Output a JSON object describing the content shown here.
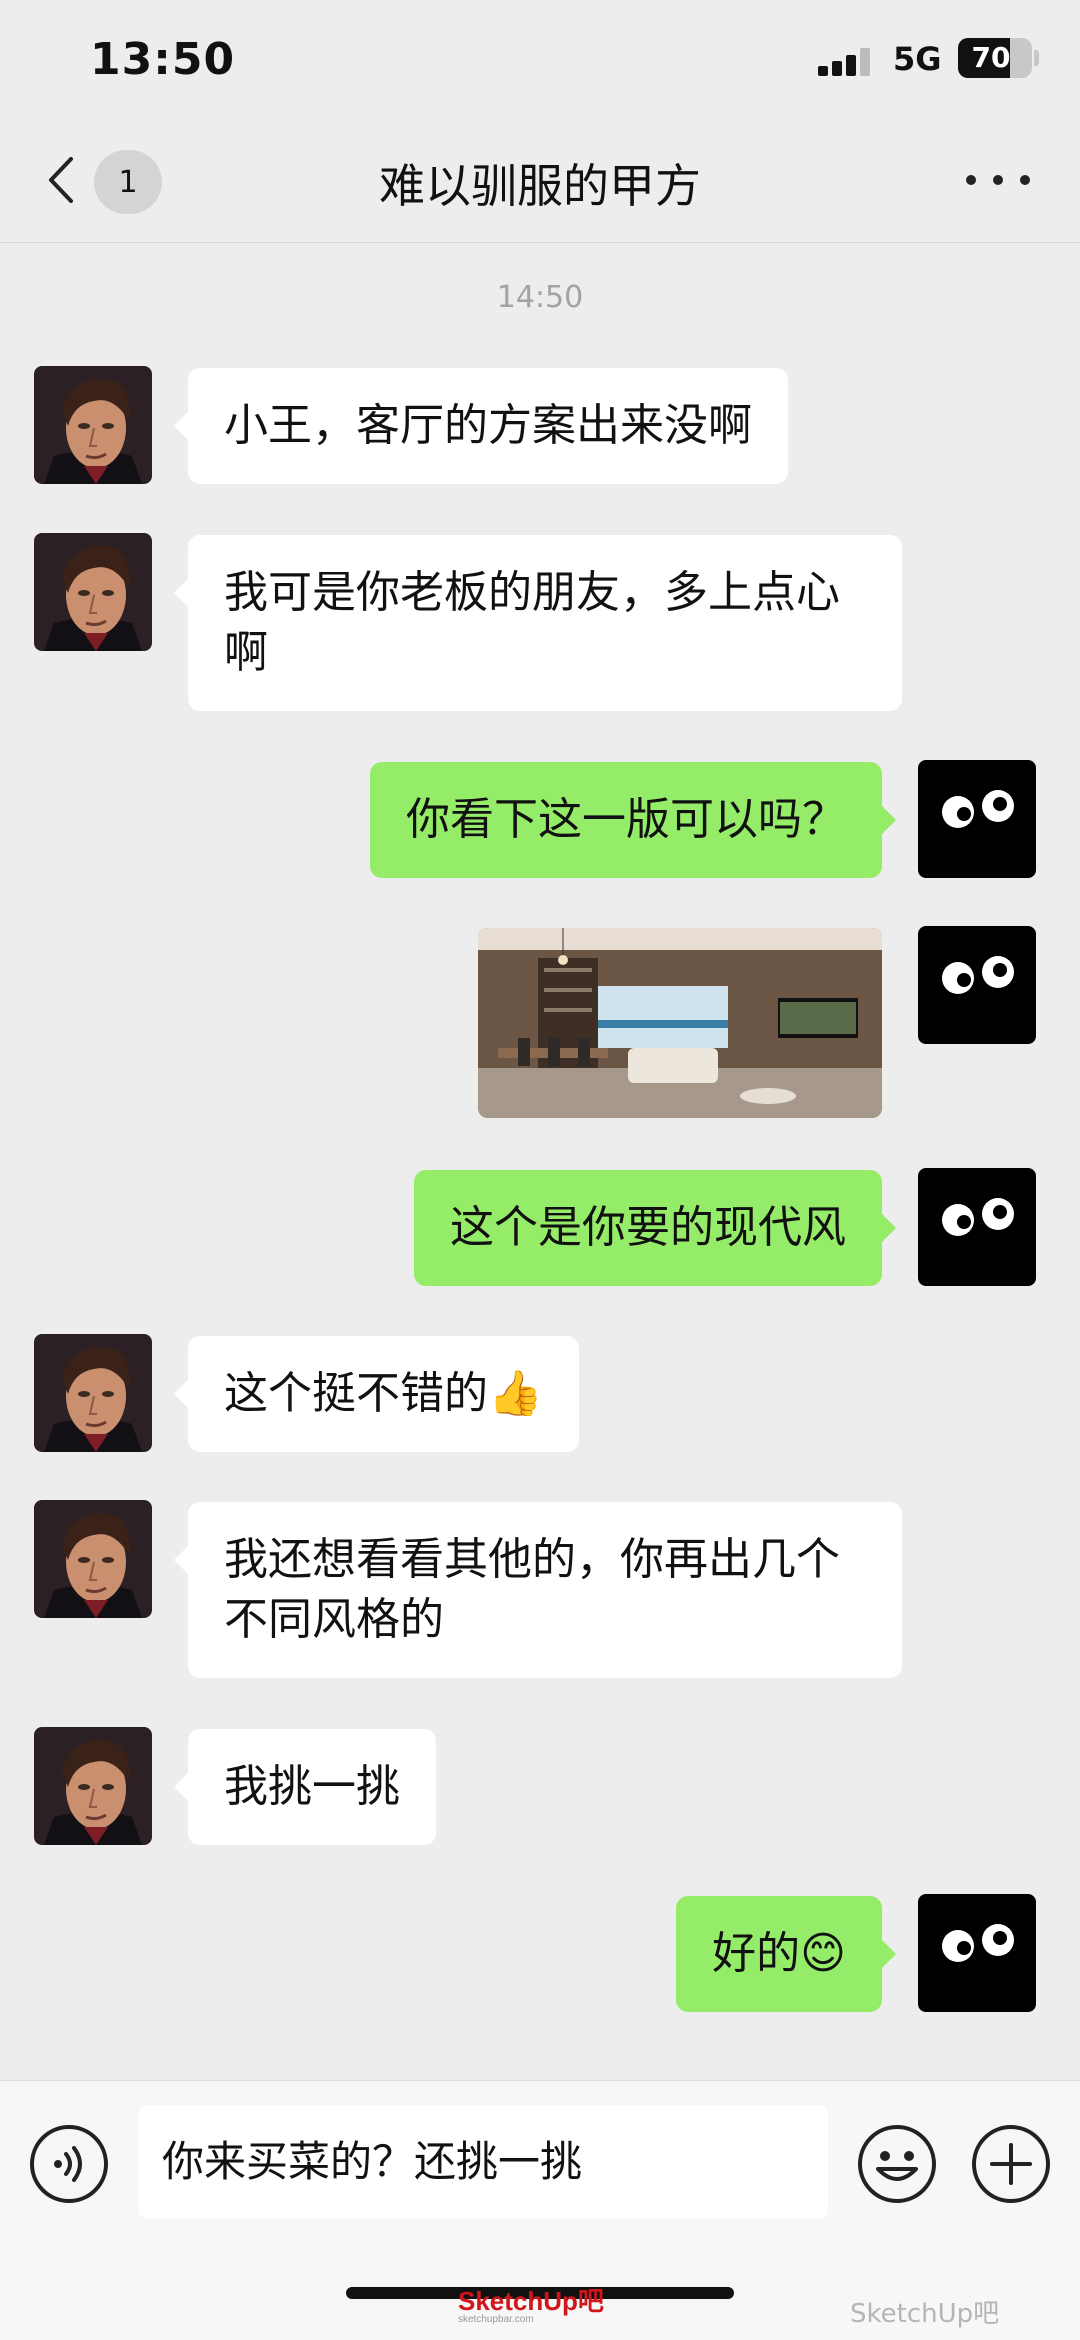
{
  "status_bar": {
    "time": "13:50",
    "network": "5G",
    "battery": "70",
    "battery_level": 0.7
  },
  "nav": {
    "back_label": "",
    "unread_badge": "1",
    "title": "难以驯服的甲方"
  },
  "timestamp": "14:50",
  "messages": [
    {
      "side": "left",
      "type": "text",
      "text": "小王，客厅的方案出来没啊"
    },
    {
      "side": "left",
      "type": "text",
      "text": "我可是你老板的朋友，多上点心啊"
    },
    {
      "side": "right",
      "type": "text",
      "text": "你看下这一版可以吗？"
    },
    {
      "side": "right",
      "type": "image"
    },
    {
      "side": "right",
      "type": "text",
      "text": "这个是你要的现代风"
    },
    {
      "side": "left",
      "type": "text",
      "text": "这个挺不错的👍"
    },
    {
      "side": "left",
      "type": "text",
      "text": "我还想看看其他的，你再出几个不同风格的"
    },
    {
      "side": "left",
      "type": "text",
      "text": "我挑一挑"
    },
    {
      "side": "right",
      "type": "text",
      "text": "好的😊"
    }
  ],
  "input": {
    "value": "你来买菜的？还挑一挑"
  },
  "watermark": {
    "logo": "SketchUp吧",
    "logo_sub": "sketchupbar.com",
    "right": "SketchUp吧"
  },
  "colors": {
    "background": "#ededed",
    "sent_bubble": "#95ec69",
    "received_bubble": "#ffffff",
    "input_bar": "#f7f7f7"
  }
}
